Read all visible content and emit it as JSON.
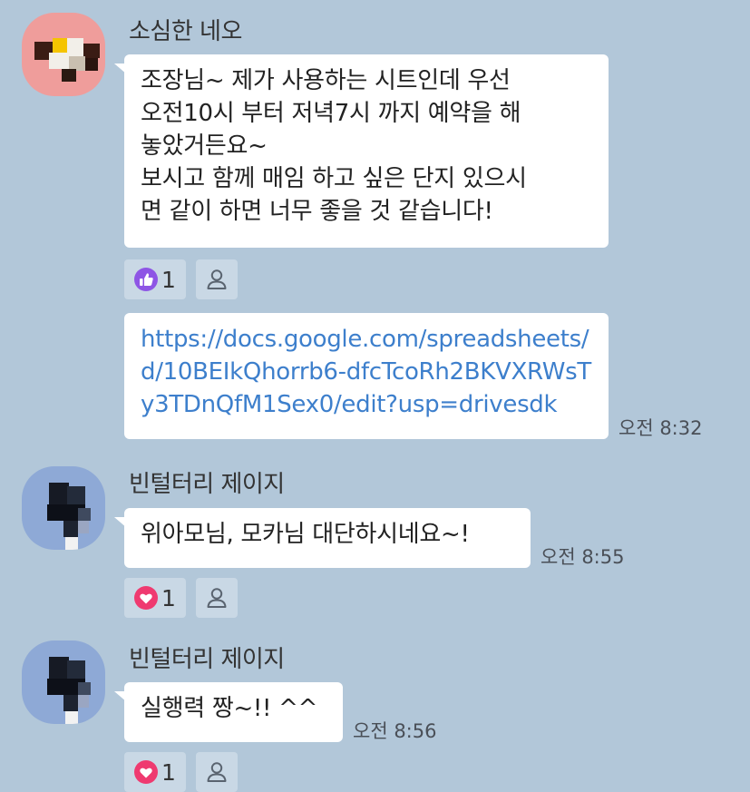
{
  "colors": {
    "background": "#b2c7d9",
    "bubble": "#ffffff",
    "link": "#3d7fcc",
    "like": "#8e55e5",
    "heart": "#ef3a70"
  },
  "messages": [
    {
      "sender": "소심한 네오",
      "avatar_icon": "pixelated-avatar-icon",
      "bubbles": [
        {
          "lines": [
            "조장님~ 제가 사용하는 시트인데 우선",
            "오전10시 부터 저녁7시 까지 예약을 해",
            "놓았거든요~",
            "보시고 함께 매임 하고 싶은 단지 있으시",
            "면 같이 하면 너무 좋을 것 같습니다!"
          ]
        },
        {
          "link_lines": [
            "https://docs.google.com/spreadsheets/",
            "d/10BEIkQhorrb6-dfcTcoRh2BKVXRWsT",
            "y3TDnQfM1Sex0/edit?usp=drivesdk"
          ],
          "time": "오전 8:32"
        }
      ],
      "reaction": {
        "icon": "thumbs-up-icon",
        "count": "1"
      }
    },
    {
      "sender": "빈털터리 제이지",
      "avatar_icon": "pixelated-avatar-icon",
      "bubbles": [
        {
          "lines": [
            "위아모님, 모카님 대단하시네요~!"
          ],
          "time": "오전 8:55"
        }
      ],
      "reaction": {
        "icon": "heart-icon",
        "count": "1"
      }
    },
    {
      "sender": "빈털터리 제이지",
      "avatar_icon": "pixelated-avatar-icon",
      "bubbles": [
        {
          "lines": [
            "실행력 짱~!! ^^"
          ],
          "time": "오전 8:56"
        }
      ],
      "reaction": {
        "icon": "heart-icon",
        "count": "1"
      }
    }
  ]
}
